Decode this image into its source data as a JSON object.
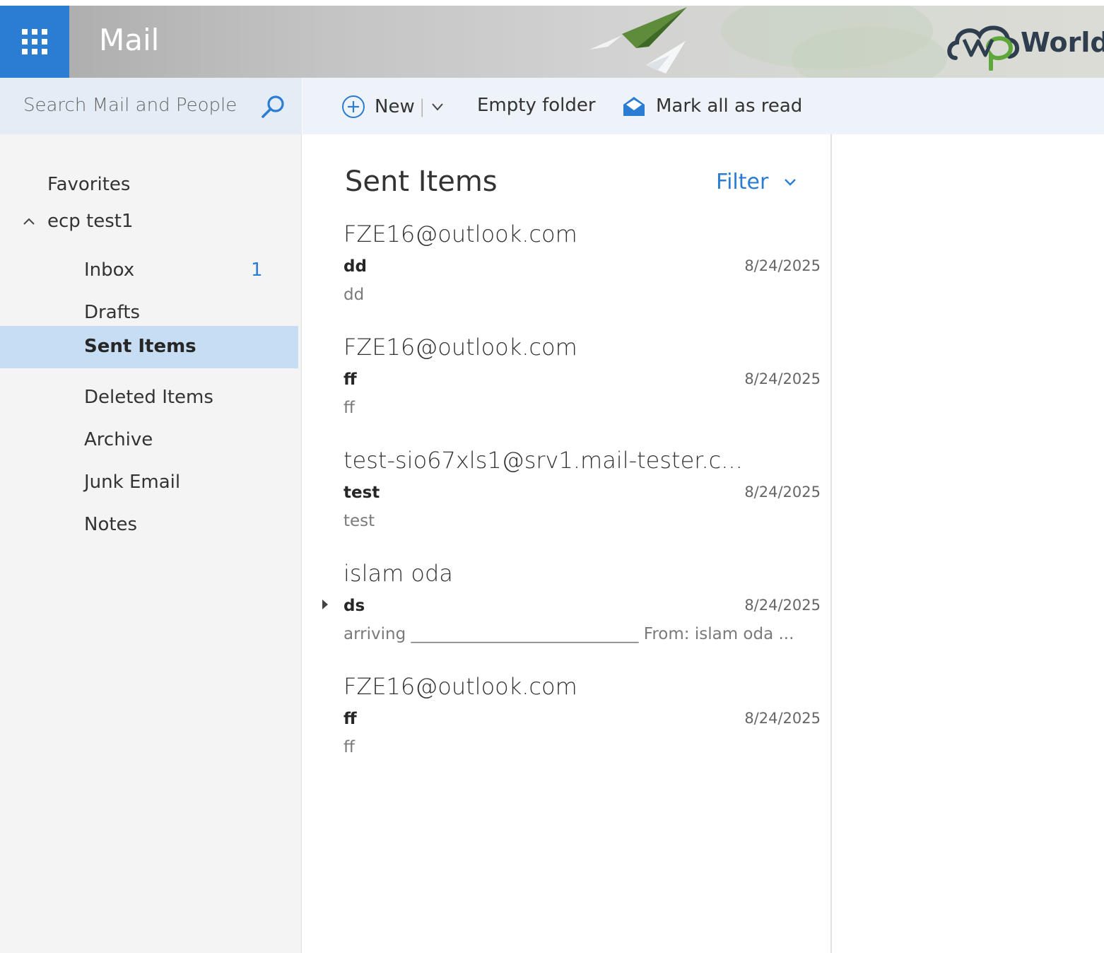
{
  "app": {
    "title": "Mail",
    "brand_text": "World"
  },
  "search": {
    "placeholder": "Search Mail and People"
  },
  "nav": {
    "favorites_label": "Favorites",
    "account_label": "ecp test1",
    "items": [
      {
        "label": "Inbox",
        "count": "1"
      },
      {
        "label": "Drafts"
      },
      {
        "label": "Sent Items",
        "selected": true
      },
      {
        "label": "Deleted Items"
      },
      {
        "label": "Archive"
      },
      {
        "label": "Junk Email"
      },
      {
        "label": "Notes"
      }
    ]
  },
  "toolbar": {
    "new_label": "New",
    "separator": "|",
    "empty_folder_label": "Empty folder",
    "mark_all_read_label": "Mark all as read"
  },
  "list": {
    "folder_title": "Sent Items",
    "filter_label": "Filter",
    "messages": [
      {
        "sender": "FZE16@outlook.com",
        "subject": "dd",
        "date": "8/24/2025",
        "preview": "dd"
      },
      {
        "sender": "FZE16@outlook.com",
        "subject": "ff",
        "date": "8/24/2025",
        "preview": "ff"
      },
      {
        "sender": "test-sio67xls1@srv1.mail-tester.c...",
        "subject": "test",
        "date": "8/24/2025",
        "preview": "test"
      },
      {
        "sender": "islam oda",
        "subject": "ds",
        "date": "8/24/2025",
        "preview": "arriving ____________________________ From: islam oda ..."
      },
      {
        "sender": "FZE16@outlook.com",
        "subject": "ff",
        "date": "8/24/2025",
        "preview": "ff"
      }
    ]
  },
  "colors": {
    "accent": "#2b7cd3",
    "selected_nav": "#c7ddf3",
    "search_bg": "#e4ecf5",
    "command_bg": "#eef3fa"
  },
  "icons": {
    "launcher": "app-launcher-icon",
    "search": "search-icon",
    "new": "plus-circle-icon",
    "dropdown": "chevron-down-icon",
    "mark_read": "open-envelope-icon",
    "collapse": "chevron-up-icon",
    "expand": "triangle-right-icon"
  }
}
